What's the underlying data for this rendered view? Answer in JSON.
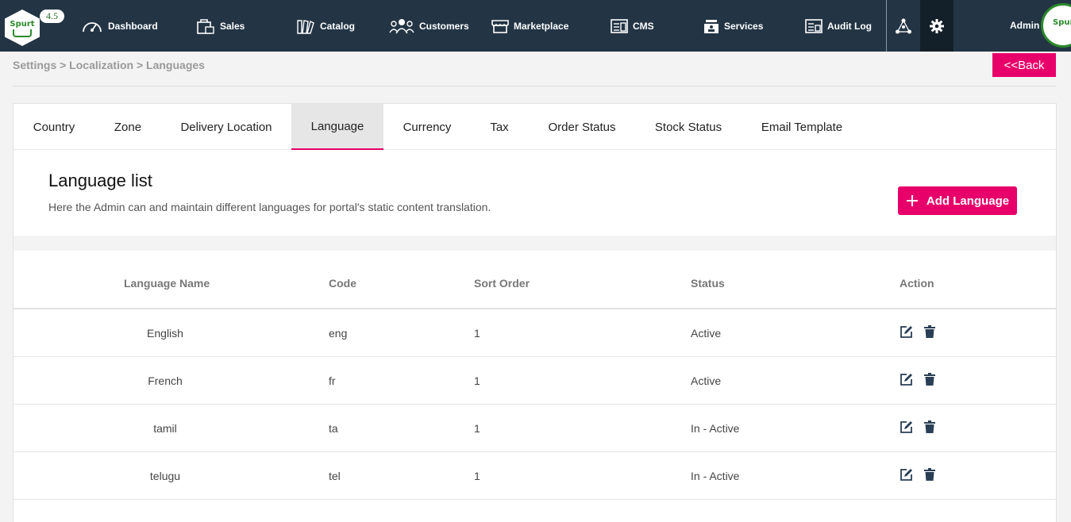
{
  "app": {
    "logo_text": "Spurt",
    "version": "4.5",
    "admin_label": "Admin"
  },
  "nav": [
    {
      "label": "Dashboard",
      "icon": "speedometer-icon"
    },
    {
      "label": "Sales",
      "icon": "shopping-bag-icon"
    },
    {
      "label": "Catalog",
      "icon": "catalog-icon"
    },
    {
      "label": "Customers",
      "icon": "users-icon"
    },
    {
      "label": "Marketplace",
      "icon": "store-icon"
    },
    {
      "label": "CMS",
      "icon": "cms-icon"
    },
    {
      "label": "Services",
      "icon": "services-icon"
    },
    {
      "label": "Audit Log",
      "icon": "audit-log-icon"
    }
  ],
  "breadcrumb": "Settings > Localization > Languages",
  "back_label": "<<Back",
  "tabs": [
    "Country",
    "Zone",
    "Delivery Location",
    "Language",
    "Currency",
    "Tax",
    "Order Status",
    "Stock Status",
    "Email Template"
  ],
  "active_tab": "Language",
  "section": {
    "title": "Language list",
    "description": "Here the Admin can and maintain different languages for portal's static content translation.",
    "add_label": "Add Language"
  },
  "table": {
    "headers": [
      "Language Name",
      "Code",
      "Sort Order",
      "Status",
      "Action"
    ],
    "rows": [
      {
        "name": "English",
        "code": "eng",
        "sort": "1",
        "status": "Active"
      },
      {
        "name": "French",
        "code": "fr",
        "sort": "1",
        "status": "Active"
      },
      {
        "name": "tamil",
        "code": "ta",
        "sort": "1",
        "status": "In - Active"
      },
      {
        "name": "telugu",
        "code": "tel",
        "sort": "1",
        "status": "In - Active"
      }
    ]
  },
  "colors": {
    "topbar": "#233545",
    "accent": "#e8006a",
    "brand_green": "#2b8a2b"
  }
}
